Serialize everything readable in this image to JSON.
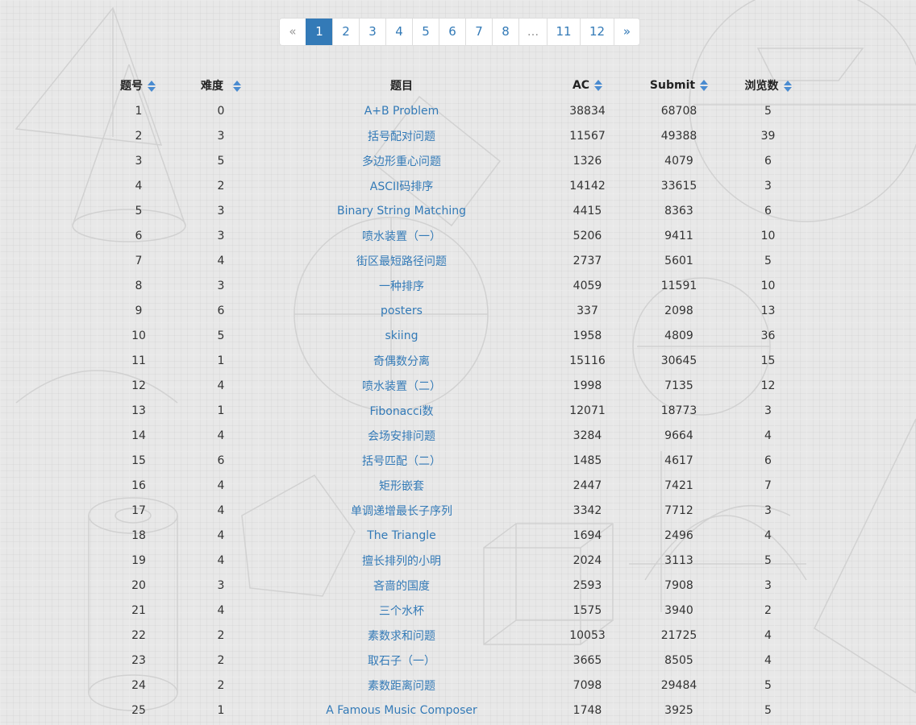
{
  "pagination": {
    "prev_label": "«",
    "next_label": "»",
    "ellipsis": "...",
    "pages": [
      "1",
      "2",
      "3",
      "4",
      "5",
      "6",
      "7",
      "8"
    ],
    "tail_pages": [
      "11",
      "12"
    ],
    "current_page": "1"
  },
  "table": {
    "headers": {
      "id": "题号",
      "difficulty": "难度",
      "title": "题目",
      "ac": "AC",
      "submit": "Submit",
      "views": "浏览数"
    },
    "rows": [
      {
        "id": "1",
        "difficulty": "0",
        "title": "A+B Problem",
        "ac": "38834",
        "submit": "68708",
        "views": "5"
      },
      {
        "id": "2",
        "difficulty": "3",
        "title": "括号配对问题",
        "ac": "11567",
        "submit": "49388",
        "views": "39"
      },
      {
        "id": "3",
        "difficulty": "5",
        "title": "多边形重心问题",
        "ac": "1326",
        "submit": "4079",
        "views": "6"
      },
      {
        "id": "4",
        "difficulty": "2",
        "title": "ASCII码排序",
        "ac": "14142",
        "submit": "33615",
        "views": "3"
      },
      {
        "id": "5",
        "difficulty": "3",
        "title": "Binary String Matching",
        "ac": "4415",
        "submit": "8363",
        "views": "6"
      },
      {
        "id": "6",
        "difficulty": "3",
        "title": "喷水装置（一）",
        "ac": "5206",
        "submit": "9411",
        "views": "10"
      },
      {
        "id": "7",
        "difficulty": "4",
        "title": "街区最短路径问题",
        "ac": "2737",
        "submit": "5601",
        "views": "5"
      },
      {
        "id": "8",
        "difficulty": "3",
        "title": "一种排序",
        "ac": "4059",
        "submit": "11591",
        "views": "10"
      },
      {
        "id": "9",
        "difficulty": "6",
        "title": "posters",
        "ac": "337",
        "submit": "2098",
        "views": "13"
      },
      {
        "id": "10",
        "difficulty": "5",
        "title": "skiing",
        "ac": "1958",
        "submit": "4809",
        "views": "36"
      },
      {
        "id": "11",
        "difficulty": "1",
        "title": "奇偶数分离",
        "ac": "15116",
        "submit": "30645",
        "views": "15"
      },
      {
        "id": "12",
        "difficulty": "4",
        "title": "喷水装置（二）",
        "ac": "1998",
        "submit": "7135",
        "views": "12"
      },
      {
        "id": "13",
        "difficulty": "1",
        "title": "Fibonacci数",
        "ac": "12071",
        "submit": "18773",
        "views": "3"
      },
      {
        "id": "14",
        "difficulty": "4",
        "title": "会场安排问题",
        "ac": "3284",
        "submit": "9664",
        "views": "4"
      },
      {
        "id": "15",
        "difficulty": "6",
        "title": "括号匹配（二）",
        "ac": "1485",
        "submit": "4617",
        "views": "6"
      },
      {
        "id": "16",
        "difficulty": "4",
        "title": "矩形嵌套",
        "ac": "2447",
        "submit": "7421",
        "views": "7"
      },
      {
        "id": "17",
        "difficulty": "4",
        "title": "单调递增最长子序列",
        "ac": "3342",
        "submit": "7712",
        "views": "3"
      },
      {
        "id": "18",
        "difficulty": "4",
        "title": "The Triangle",
        "ac": "1694",
        "submit": "2496",
        "views": "4"
      },
      {
        "id": "19",
        "difficulty": "4",
        "title": "擅长排列的小明",
        "ac": "2024",
        "submit": "3113",
        "views": "5"
      },
      {
        "id": "20",
        "difficulty": "3",
        "title": "吝啬的国度",
        "ac": "2593",
        "submit": "7908",
        "views": "3"
      },
      {
        "id": "21",
        "difficulty": "4",
        "title": "三个水杯",
        "ac": "1575",
        "submit": "3940",
        "views": "2"
      },
      {
        "id": "22",
        "difficulty": "2",
        "title": "素数求和问题",
        "ac": "10053",
        "submit": "21725",
        "views": "4"
      },
      {
        "id": "23",
        "difficulty": "2",
        "title": "取石子（一）",
        "ac": "3665",
        "submit": "8505",
        "views": "4"
      },
      {
        "id": "24",
        "difficulty": "2",
        "title": "素数距离问题",
        "ac": "7098",
        "submit": "29484",
        "views": "5"
      },
      {
        "id": "25",
        "difficulty": "1",
        "title": "A Famous Music Composer",
        "ac": "1748",
        "submit": "3925",
        "views": "5"
      }
    ]
  },
  "icons": {
    "sort": "sort-icon"
  },
  "colors": {
    "link": "#337ab7",
    "active_page_bg": "#337ab7",
    "sort_icon": "#4a8bd0",
    "background": "#e8e8e8"
  }
}
